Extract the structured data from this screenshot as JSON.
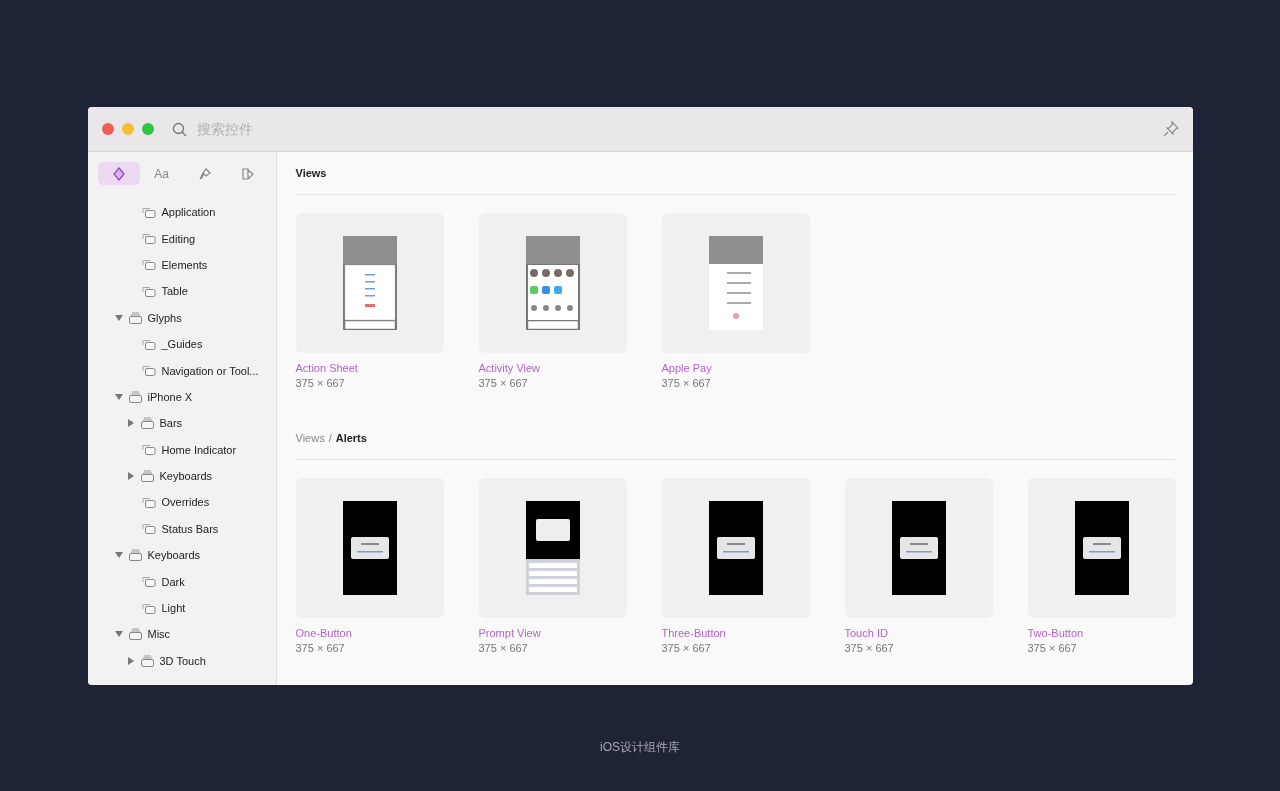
{
  "window": {
    "search": {
      "placeholder": "搜索控件"
    }
  },
  "sidebar": {
    "tabs": [
      {
        "kind": "symbol",
        "selected": true
      },
      {
        "kind": "text",
        "label": "Aa",
        "selected": false
      },
      {
        "kind": "brush",
        "selected": false
      },
      {
        "kind": "swatch",
        "selected": false
      }
    ],
    "tree": [
      {
        "children": [
          {
            "label": "Application"
          },
          {
            "label": "Editing"
          },
          {
            "label": "Elements"
          },
          {
            "label": "Table"
          }
        ]
      },
      {
        "label": "Glyphs",
        "expanded": true,
        "children": [
          {
            "label": "_Guides"
          },
          {
            "label": "Navigation or Tool..."
          }
        ]
      },
      {
        "label": "iPhone X",
        "expanded": true,
        "children": [
          {
            "label": "Bars",
            "expanded": false
          },
          {
            "label": "Home Indicator"
          },
          {
            "label": "Keyboards",
            "expanded": false
          },
          {
            "label": "Overrides"
          },
          {
            "label": "Status Bars"
          }
        ]
      },
      {
        "label": "Keyboards",
        "expanded": true,
        "children": [
          {
            "label": "Dark"
          },
          {
            "label": "Light"
          }
        ]
      },
      {
        "label": "Misc",
        "expanded": true,
        "children": [
          {
            "label": "3D Touch",
            "expanded": false
          }
        ]
      }
    ]
  },
  "sections": [
    {
      "breadcrumb": [
        "Views"
      ],
      "items": [
        {
          "name": "Action Sheet",
          "size": "375 × 667",
          "kind": "sheet"
        },
        {
          "name": "Activity View",
          "size": "375 × 667",
          "kind": "activity"
        },
        {
          "name": "Apple Pay",
          "size": "375 × 667",
          "kind": "pay"
        }
      ]
    },
    {
      "breadcrumb": [
        "Views",
        "Alerts"
      ],
      "separator": "/",
      "items": [
        {
          "name": "One-Button",
          "size": "375 × 667",
          "kind": "alert"
        },
        {
          "name": "Prompt View",
          "size": "375 × 667",
          "kind": "prompt"
        },
        {
          "name": "Three-Button",
          "size": "375 × 667",
          "kind": "alert"
        },
        {
          "name": "Touch ID",
          "size": "375 × 667",
          "kind": "alert"
        },
        {
          "name": "Two-Button",
          "size": "375 × 667",
          "kind": "alert"
        }
      ]
    }
  ],
  "caption": "iOS设计组件库"
}
